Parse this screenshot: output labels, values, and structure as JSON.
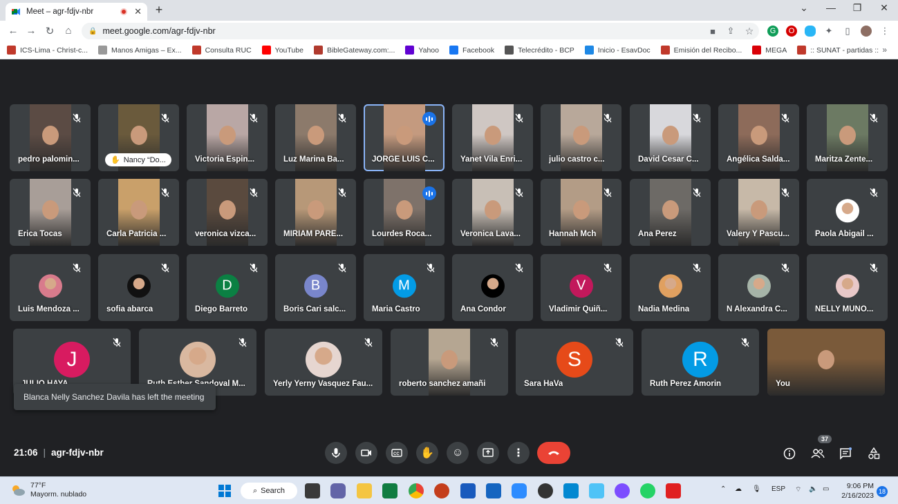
{
  "browser": {
    "tab_title": "Meet – agr-fdjv-nbr",
    "url": "meet.google.com/agr-fdjv-nbr",
    "bookmarks": [
      {
        "label": "ICS-Lima - Christ-c...",
        "color": "#c0392b"
      },
      {
        "label": "Manos Amigas – Ex...",
        "color": "#999999"
      },
      {
        "label": "Consulta RUC",
        "color": "#c0392b"
      },
      {
        "label": "YouTube",
        "color": "#ff0000"
      },
      {
        "label": "BibleGateway.com:...",
        "color": "#b03a2e"
      },
      {
        "label": "Yahoo",
        "color": "#6001d2"
      },
      {
        "label": "Facebook",
        "color": "#1877f2"
      },
      {
        "label": "Telecrédito - BCP",
        "color": "#555555"
      },
      {
        "label": "Inicio - EsavDoc",
        "color": "#1e88e5"
      },
      {
        "label": "Emisión del Recibo...",
        "color": "#c0392b"
      },
      {
        "label": "MEGA",
        "color": "#d90007"
      },
      {
        "label": ":: SUNAT - partidas ::",
        "color": "#c0392b"
      }
    ]
  },
  "participants": {
    "row1": [
      {
        "name": "pedro palomin...",
        "type": "video",
        "bg": "#5b4b44"
      },
      {
        "name": "Nancy “Do...",
        "type": "video",
        "bg": "#6a5a3c",
        "hand": true
      },
      {
        "name": "Victoria Espin...",
        "type": "video",
        "bg": "#b9a7a5"
      },
      {
        "name": "Luz Marina Ba...",
        "type": "video",
        "bg": "#8c7a6b"
      },
      {
        "name": "JORGE LUIS C...",
        "type": "video",
        "bg": "#c49a7f",
        "speaking": true
      },
      {
        "name": "Yanet Vila Enri...",
        "type": "video",
        "bg": "#cfc7c3"
      },
      {
        "name": "julio castro c...",
        "type": "video",
        "bg": "#b8a89a"
      },
      {
        "name": "David Cesar C...",
        "type": "video",
        "bg": "#d8d8dc"
      },
      {
        "name": "Angélica Salda...",
        "type": "video",
        "bg": "#8d6b5a"
      },
      {
        "name": "Maritza Zente...",
        "type": "video",
        "bg": "#6c7a63"
      }
    ],
    "row2": [
      {
        "name": "Erica Tocas",
        "type": "video",
        "bg": "#a89e98"
      },
      {
        "name": "Carla Patricia ...",
        "type": "video",
        "bg": "#c9a06a"
      },
      {
        "name": "veronica vizca...",
        "type": "video",
        "bg": "#5a4a3e"
      },
      {
        "name": "MIRIAM PARE...",
        "type": "video",
        "bg": "#b79878"
      },
      {
        "name": "Lourdes Roca...",
        "type": "video",
        "bg": "#7e726a",
        "speaking_indicator": true
      },
      {
        "name": "Veronica Lava...",
        "type": "video",
        "bg": "#c8bfb6"
      },
      {
        "name": "Hannah Mch",
        "type": "video",
        "bg": "#b39c86"
      },
      {
        "name": "Ana Perez",
        "type": "video",
        "bg": "#6d6a66"
      },
      {
        "name": "Valery Y Pascu...",
        "type": "video",
        "bg": "#c7b9a8"
      },
      {
        "name": "Paola Abigail ...",
        "type": "photo",
        "bg": "#ffffff"
      }
    ],
    "row3": [
      {
        "name": "Luis Mendoza ...",
        "type": "photo",
        "bg": "#d87b8c"
      },
      {
        "name": "sofia abarca",
        "type": "photo",
        "bg": "#111111"
      },
      {
        "name": "Diego Barreto",
        "type": "letter",
        "letter": "D",
        "bg": "#0b8043"
      },
      {
        "name": "Boris Cari salc...",
        "type": "letter",
        "letter": "B",
        "bg": "#7986cb"
      },
      {
        "name": "Maria Castro",
        "type": "letter",
        "letter": "M",
        "bg": "#039be5"
      },
      {
        "name": "Ana Condor",
        "type": "photo",
        "bg": "#000000"
      },
      {
        "name": "Vladimir Quiñ...",
        "type": "letter",
        "letter": "V",
        "bg": "#c2185b"
      },
      {
        "name": "Nadia Medina",
        "type": "photo",
        "bg": "#e0a060"
      },
      {
        "name": "N Alexandra C...",
        "type": "photo",
        "bg": "#a6b4a8"
      },
      {
        "name": "NELLY MUÑO...",
        "type": "photo",
        "bg": "#e8c8c8"
      }
    ],
    "row4": [
      {
        "name": "JULIO HAYA",
        "type": "letter",
        "letter": "J",
        "bg": "#d81b60"
      },
      {
        "name": "Ruth Esther Sandoval M...",
        "type": "photo",
        "bg": "#d9b8a0"
      },
      {
        "name": "Yerly Yerny Vasquez Fau...",
        "type": "photo",
        "bg": "#e6d6d0"
      },
      {
        "name": "roberto sanchez amañi",
        "type": "video",
        "bg": "#b5a692"
      },
      {
        "name": "Sara HaVa",
        "type": "letter",
        "letter": "S",
        "bg": "#e64a19"
      },
      {
        "name": "Ruth Perez Amorin",
        "type": "letter",
        "letter": "R",
        "bg": "#039be5"
      },
      {
        "name": "You",
        "type": "self",
        "bg": "#7a5a3a"
      }
    ]
  },
  "toast": "Blanca Nelly Sanchez Davila has left the meeting",
  "meeting": {
    "time": "21:06",
    "code": "agr-fdjv-nbr",
    "people_count": "37"
  },
  "colors": {
    "end_call": "#ea4335",
    "speaking": "#1a73e8",
    "meet_bg": "#202124",
    "tile_bg": "#3c4043"
  },
  "taskbar": {
    "temp": "77°F",
    "weather": "Mayorm. nublado",
    "search": "Search",
    "lang": "ESP",
    "time": "9:06 PM",
    "date": "2/16/2023",
    "notifications": "18"
  }
}
